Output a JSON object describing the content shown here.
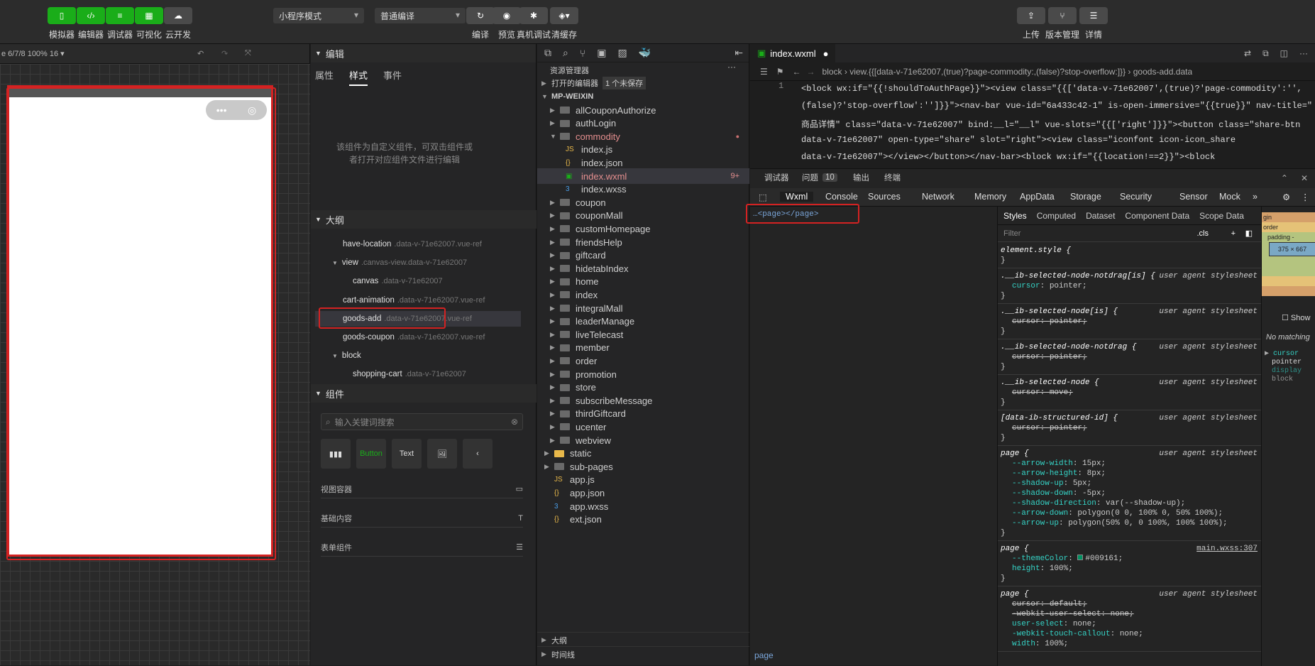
{
  "toolbar": {
    "buttons": [
      {
        "label": "模拟器",
        "icon": "phone-icon"
      },
      {
        "label": "编辑器",
        "icon": "code-icon"
      },
      {
        "label": "调试器",
        "icon": "debug-icon"
      },
      {
        "label": "可视化",
        "icon": "layout-icon"
      },
      {
        "label": "云开发",
        "icon": "cloud-icon"
      }
    ],
    "mode_select": "小程序模式",
    "compile_select": "普通编译",
    "mid_buttons": [
      "编译",
      "预览",
      "真机调试",
      "清缓存"
    ],
    "right_buttons": [
      "上传",
      "版本管理",
      "详情"
    ]
  },
  "simulator": {
    "device_info": "e 6/7/8 100% 16 ▾",
    "capsule_more": "•••"
  },
  "editor_panel": {
    "section_title": "编辑",
    "tabs": [
      "属性",
      "样式",
      "事件"
    ],
    "active_tab": "样式",
    "notice": "该组件为自定义组件，可双击组件或者打开对应组件文件进行编辑",
    "outline_title": "大纲",
    "outline": [
      {
        "name": "have-location",
        "sub": ".data-v-71e62007.vue-ref"
      },
      {
        "name": "view",
        "sub": ".canvas-view.data-v-71e62007"
      },
      {
        "name": "canvas",
        "sub": ".data-v-71e62007"
      },
      {
        "name": "cart-animation",
        "sub": ".data-v-71e62007.vue-ref"
      },
      {
        "name": "goods-add",
        "sub": ".data-v-71e62007.vue-ref"
      },
      {
        "name": "goods-coupon",
        "sub": ".data-v-71e62007.vue-ref"
      },
      {
        "name": "block",
        "sub": ""
      },
      {
        "name": "shopping-cart",
        "sub": ".data-v-71e62007"
      }
    ],
    "components_title": "组件",
    "search_placeholder": "输入关键词搜索",
    "comp_items": [
      "▮▮▮",
      "Button",
      "Text",
      "🖼",
      "‹"
    ],
    "categories": [
      "视图容器",
      "基础内容",
      "表单组件"
    ]
  },
  "explorer": {
    "title": "资源管理器",
    "open_editors": "打开的编辑器",
    "unsaved": "1 个未保存",
    "root": "MP-WEIXIN",
    "items": [
      {
        "name": "allCouponAuthorize",
        "type": "folder",
        "depth": 1
      },
      {
        "name": "authLogin",
        "type": "folder",
        "depth": 1
      },
      {
        "name": "commodity",
        "type": "folder-open",
        "depth": 1
      },
      {
        "name": "index.js",
        "type": "js",
        "depth": 2
      },
      {
        "name": "index.json",
        "type": "json",
        "depth": 2
      },
      {
        "name": "index.wxml",
        "type": "wxml",
        "depth": 2,
        "badge": "9+"
      },
      {
        "name": "index.wxss",
        "type": "wxss",
        "depth": 2
      },
      {
        "name": "coupon",
        "type": "folder",
        "depth": 1
      },
      {
        "name": "couponMall",
        "type": "folder",
        "depth": 1
      },
      {
        "name": "customHomepage",
        "type": "folder",
        "depth": 1
      },
      {
        "name": "friendsHelp",
        "type": "folder",
        "depth": 1
      },
      {
        "name": "giftcard",
        "type": "folder",
        "depth": 1
      },
      {
        "name": "hidetabIndex",
        "type": "folder",
        "depth": 1
      },
      {
        "name": "home",
        "type": "folder",
        "depth": 1
      },
      {
        "name": "index",
        "type": "folder",
        "depth": 1
      },
      {
        "name": "integralMall",
        "type": "folder",
        "depth": 1
      },
      {
        "name": "leaderManage",
        "type": "folder",
        "depth": 1
      },
      {
        "name": "liveTelecast",
        "type": "folder",
        "depth": 1
      },
      {
        "name": "member",
        "type": "folder",
        "depth": 1
      },
      {
        "name": "order",
        "type": "folder",
        "depth": 1
      },
      {
        "name": "promotion",
        "type": "folder",
        "depth": 1
      },
      {
        "name": "store",
        "type": "folder",
        "depth": 1
      },
      {
        "name": "subscribeMessage",
        "type": "folder",
        "depth": 1
      },
      {
        "name": "thirdGiftcard",
        "type": "folder",
        "depth": 1
      },
      {
        "name": "ucenter",
        "type": "folder",
        "depth": 1
      },
      {
        "name": "webview",
        "type": "folder",
        "depth": 1
      },
      {
        "name": "static",
        "type": "folder-y",
        "depth": 0
      },
      {
        "name": "sub-pages",
        "type": "folder",
        "depth": 0
      },
      {
        "name": "app.js",
        "type": "js",
        "depth": 0
      },
      {
        "name": "app.json",
        "type": "json",
        "depth": 0
      },
      {
        "name": "app.wxss",
        "type": "wxss",
        "depth": 0
      },
      {
        "name": "ext.json",
        "type": "json",
        "depth": 0
      }
    ],
    "outline": "大纲",
    "timeline": "时间线"
  },
  "code_editor": {
    "tab": "index.wxml",
    "breadcrumb": "block  ›  view.{{[data-v-71e62007,(true)?page-commodity:,(false)?stop-overflow:]}}  ›  goods-add.data",
    "line_no": "1",
    "lines": [
      "<block wx:if=\"{{!shouldToAuthPage}}\"><view class=\"{{['data-v-71e62007',(true)?'page-commodity':'',",
      "(false)?'stop-overflow':'']}}\"><nav-bar vue-id=\"6a433c42-1\" is-open-immersive=\"{{true}}\" nav-title=\"",
      "商品详情\" class=\"data-v-71e62007\" bind:__l=\"__l\" vue-slots=\"{{['right']}}\"><button class=\"share-btn",
      "data-v-71e62007\" open-type=\"share\" slot=\"right\"><view class=\"iconfont icon-icon_share",
      "data-v-71e62007\"></view></button></nav-bar><block wx:if=\"{{location!==2}}\"><block"
    ]
  },
  "devtools": {
    "top_tabs": [
      "调试器",
      "问题",
      "输出",
      "终端"
    ],
    "issues_count": "10",
    "tabs": [
      "Wxml",
      "Console",
      "Sources",
      "Network",
      "Memory",
      "AppData",
      "Storage",
      "Security",
      "Sensor",
      "Mock",
      "»"
    ],
    "wxml_node": "…<page></page>",
    "bottom_crumb": "page",
    "style_tabs": [
      "Styles",
      "Computed",
      "Dataset",
      "Component Data",
      "Scope Data"
    ],
    "filter_placeholder": "Filter",
    "cls": ".cls",
    "rules": [
      {
        "sel": "element.style {",
        "src": "",
        "props": [],
        "close": "}"
      },
      {
        "sel": ".__ib-selected-node-notdrag[is] {",
        "src": "user agent stylesheet",
        "props": [
          {
            "n": "cursor",
            "v": "pointer;",
            "s": false
          }
        ],
        "close": "}"
      },
      {
        "sel": ".__ib-selected-node[is] {",
        "src": "user agent stylesheet",
        "props": [
          {
            "n": "cursor",
            "v": "pointer;",
            "s": true
          }
        ],
        "close": "}"
      },
      {
        "sel": ".__ib-selected-node-notdrag {",
        "src": "user agent stylesheet",
        "props": [
          {
            "n": "cursor",
            "v": "pointer;",
            "s": true
          }
        ],
        "close": "}"
      },
      {
        "sel": ".__ib-selected-node {",
        "src": "user agent stylesheet",
        "props": [
          {
            "n": "cursor",
            "v": "move;",
            "s": true
          }
        ],
        "close": "}"
      },
      {
        "sel": "[data-ib-structured-id] {",
        "src": "user agent stylesheet",
        "props": [
          {
            "n": "cursor",
            "v": "pointer;",
            "s": true
          }
        ],
        "close": "}"
      },
      {
        "sel": "page {",
        "src": "user agent stylesheet",
        "props": [
          {
            "n": "--arrow-width",
            "v": "15px;",
            "s": false
          },
          {
            "n": "--arrow-height",
            "v": "8px;",
            "s": false
          },
          {
            "n": "--shadow-up",
            "v": "5px;",
            "s": false
          },
          {
            "n": "--shadow-down",
            "v": "-5px;",
            "s": false
          },
          {
            "n": "--shadow-direction",
            "v": "var(--shadow-up);",
            "s": false
          },
          {
            "n": "--arrow-down",
            "v": "polygon(0 0, 100% 0, 50% 100%);",
            "s": false
          },
          {
            "n": "--arrow-up",
            "v": "polygon(50% 0, 0 100%, 100% 100%);",
            "s": false
          }
        ],
        "close": "}"
      },
      {
        "sel": "page {",
        "src": "main.wxss:307",
        "props": [
          {
            "n": "--themeColor",
            "v": "#009161;",
            "s": false
          },
          {
            "n": "height",
            "v": "100%;",
            "s": false
          }
        ],
        "close": "}"
      },
      {
        "sel": "page {",
        "src": "user agent stylesheet",
        "props": [
          {
            "n": "cursor",
            "v": "default;",
            "s": true
          },
          {
            "n": "-webkit-user-select",
            "v": "none;",
            "s": true
          },
          {
            "n": "user-select",
            "v": "none;",
            "s": false
          },
          {
            "n": "-webkit-touch-callout",
            "v": "none;",
            "s": false
          },
          {
            "n": "width",
            "v": "100%;",
            "s": false
          }
        ],
        "close": ""
      }
    ],
    "box_labels": [
      "gin",
      "order",
      "padding -",
      "375 × 667"
    ],
    "show": "Show",
    "no_matching": "No matching",
    "computed": [
      "cursor",
      "pointer",
      "display",
      "block"
    ]
  },
  "colors": {
    "accent_green": "#1aad19",
    "highlight_red": "#d42222",
    "theme": "#009161"
  }
}
